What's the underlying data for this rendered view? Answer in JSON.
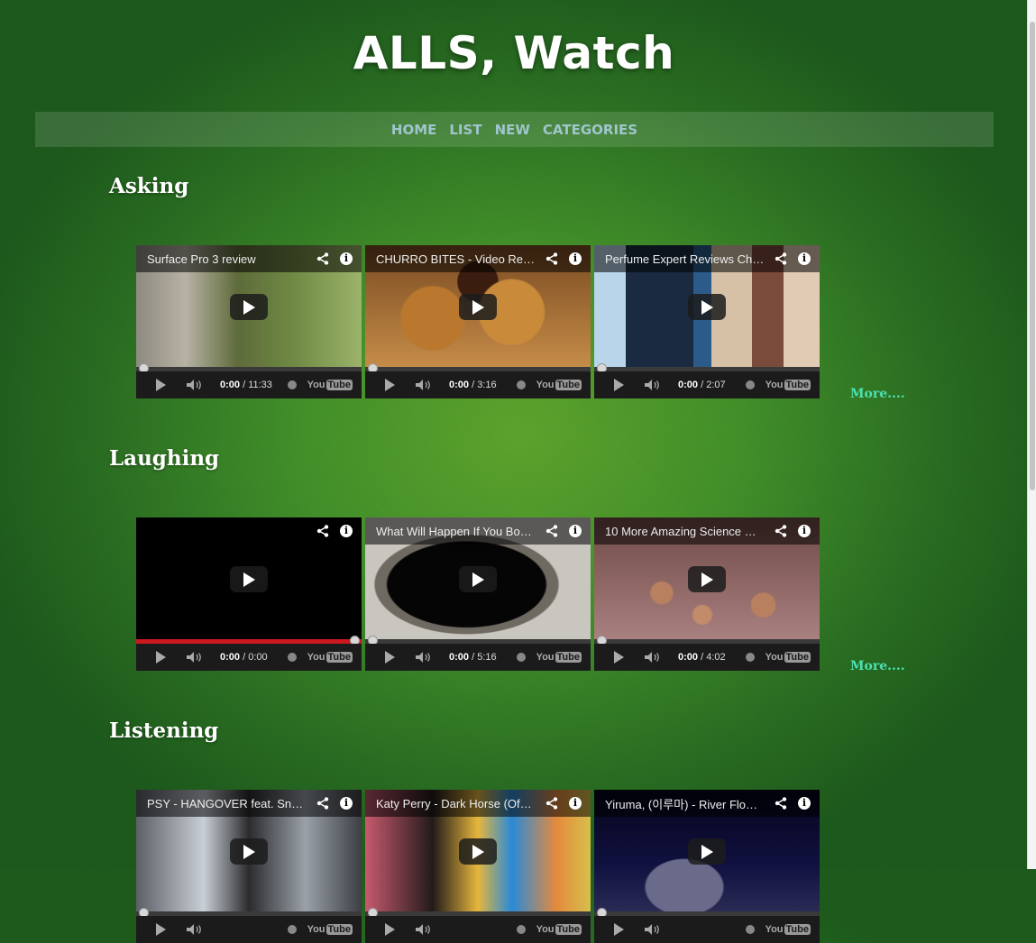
{
  "site": {
    "title": "ALLS, Watch"
  },
  "nav": {
    "items": [
      {
        "label": "HOME"
      },
      {
        "label": "LIST"
      },
      {
        "label": "NEW"
      },
      {
        "label": "CATEGORIES"
      }
    ]
  },
  "sections": [
    {
      "heading": "Asking",
      "more": "More....",
      "videos": [
        {
          "title": "Surface Pro 3 review",
          "current_time": "0:00",
          "duration": "/ 11:33",
          "progress": 0,
          "thumb": "tablet"
        },
        {
          "title": "CHURRO BITES - Video Re…",
          "current_time": "0:00",
          "duration": "/ 3:16",
          "progress": 0,
          "thumb": "churro"
        },
        {
          "title": "Perfume Expert Reviews Ch…",
          "current_time": "0:00",
          "duration": "/ 2:07",
          "progress": 0,
          "thumb": "perfume"
        }
      ]
    },
    {
      "heading": "Laughing",
      "more": "More....",
      "videos": [
        {
          "title": "",
          "current_time": "0:00",
          "duration": "/ 0:00",
          "progress": 1,
          "thumb": "black"
        },
        {
          "title": "What Will Happen If You Bo…",
          "current_time": "0:00",
          "duration": "/ 5:16",
          "progress": 0,
          "thumb": "goo"
        },
        {
          "title": "10 More Amazing Science …",
          "current_time": "0:00",
          "duration": "/ 4:02",
          "progress": 0,
          "thumb": "coins"
        }
      ]
    },
    {
      "heading": "Listening",
      "more": "",
      "videos": [
        {
          "title": "PSY - HANGOVER feat. Sn…",
          "current_time": "",
          "duration": "",
          "progress": 0,
          "thumb": "psy"
        },
        {
          "title": "Katy Perry - Dark Horse (Of…",
          "current_time": "",
          "duration": "",
          "progress": 0,
          "thumb": "katy"
        },
        {
          "title": "Yiruma, (이루마) - River Flow…",
          "current_time": "",
          "duration": "",
          "progress": 0,
          "thumb": "piano"
        }
      ]
    }
  ],
  "player": {
    "youtube_logo_text": "You",
    "youtube_logo_tube": "Tube"
  },
  "icons": {
    "share": "share-icon",
    "info": "info-icon",
    "play": "play-icon",
    "volume": "volume-icon",
    "clock": "watch-later-icon"
  },
  "colors": {
    "accent_more": "#4de0b0",
    "nav_text": "#9fc6cc",
    "progress_red": "#cc181e"
  }
}
